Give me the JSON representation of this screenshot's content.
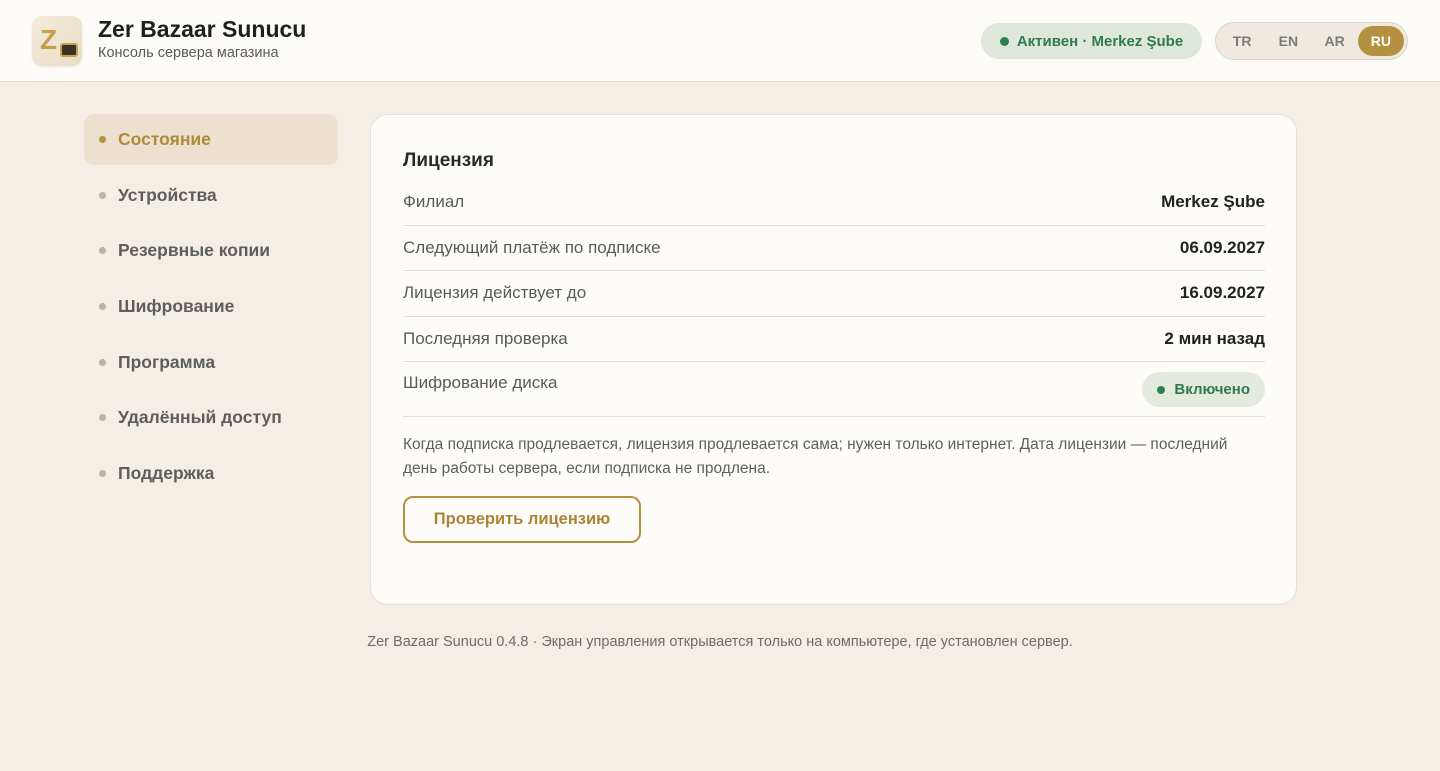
{
  "header": {
    "title": "Zer Bazaar Sunucu",
    "subtitle": "Консоль сервера магазина",
    "logo_icon": "zer-bazaar-logo-icon",
    "status": "Активен · Merkez Şube",
    "status_color": "#2f7f55",
    "languages": [
      "TR",
      "EN",
      "AR",
      "RU"
    ],
    "active_language": "RU",
    "accent_color": "#b4913f"
  },
  "sidebar": {
    "items": [
      {
        "label": "Состояние",
        "active": true
      },
      {
        "label": "Устройства",
        "active": false
      },
      {
        "label": "Резервные копии",
        "active": false
      },
      {
        "label": "Шифрование",
        "active": false
      },
      {
        "label": "Программа",
        "active": false
      },
      {
        "label": "Удалённый доступ",
        "active": false
      },
      {
        "label": "Поддержка",
        "active": false
      }
    ]
  },
  "license": {
    "title": "Лицензия",
    "rows": [
      {
        "key": "Филиал",
        "value": "Merkez Şube"
      },
      {
        "key": "Следующий платёж по подписке",
        "value": "06.09.2027"
      },
      {
        "key": "Лицензия действует до",
        "value": "16.09.2027"
      },
      {
        "key": "Последняя проверка",
        "value": "2 мин назад"
      }
    ],
    "encryption_label": "Шифрование диска",
    "encryption_status": "Включено",
    "note": "Когда подписка продлевается, лицензия продлевается сама; нужен только интернет. Дата лицензии — последний день работы сервера, если подписка не продлена.",
    "verify_button": "Проверить лицензию"
  },
  "footer": {
    "text": "Zer Bazaar Sunucu 0.4.8 · Экран управления открывается только на компьютере, где установлен сервер."
  }
}
